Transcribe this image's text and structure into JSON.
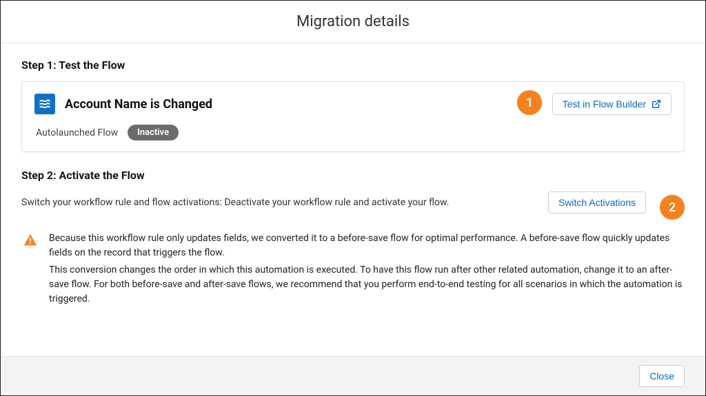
{
  "header": {
    "title": "Migration details"
  },
  "step1": {
    "heading": "Step 1: Test the Flow",
    "flow_name": "Account Name is Changed",
    "flow_type": "Autolaunched Flow",
    "flow_status": "Inactive",
    "test_button": "Test in Flow Builder"
  },
  "step2": {
    "heading": "Step 2: Activate the Flow",
    "description": "Switch your workflow rule and flow activations: Deactivate your workflow rule and activate your flow.",
    "switch_button": "Switch Activations"
  },
  "warning": {
    "p1": "Because this workflow rule only updates fields, we converted it to a before-save flow for optimal performance. A before-save flow quickly updates fields on the record that triggers the flow.",
    "p2": "This conversion changes the order in which this automation is executed. To have this flow run after other related automation, change it to an after-save flow. For both before-save and after-save flows, we recommend that you perform end-to-end testing for all scenarios in which the automation is triggered."
  },
  "footer": {
    "close": "Close"
  },
  "annotations": {
    "a1": "1",
    "a2": "2"
  }
}
